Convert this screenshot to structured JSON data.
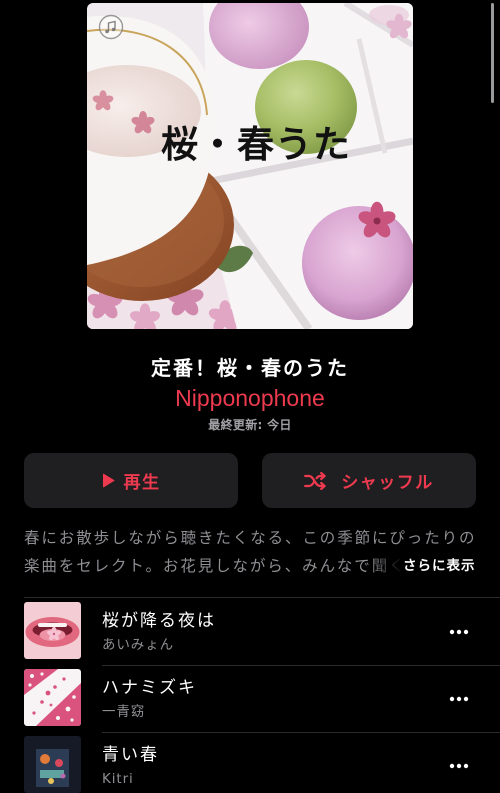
{
  "playlist": {
    "artwork_text": "桜・春うた",
    "title": "定番！桜・春のうた",
    "curator": "Nipponophone",
    "updated": "最終更新: 今日"
  },
  "actions": {
    "play_label": "再生",
    "shuffle_label": "シャッフル"
  },
  "description": {
    "lines": [
      "春にお散歩しながら聴きたくなる、この季節にぴったりの",
      "楽曲をセレクト。お花見しながら、みんなで聞く"
    ],
    "more_label": "さらに表示"
  },
  "tracks": [
    {
      "title": "桜が降る夜は",
      "artist": "あいみょん"
    },
    {
      "title": "ハナミズキ",
      "artist": "一青窈"
    },
    {
      "title": "青い春",
      "artist": "Kitri"
    }
  ],
  "icons": {
    "badge": "apple-music-badge-icon",
    "play": "play-icon",
    "shuffle": "shuffle-icon",
    "more": "more-icon"
  },
  "colors": {
    "accent": "#ee3a4f",
    "background": "#000000",
    "button": "#1f1f22",
    "secondary_text": "#8e8e93",
    "meta_text": "#a1a1a6",
    "primary_text": "#ffffff",
    "divider": "#2b2b2e"
  }
}
